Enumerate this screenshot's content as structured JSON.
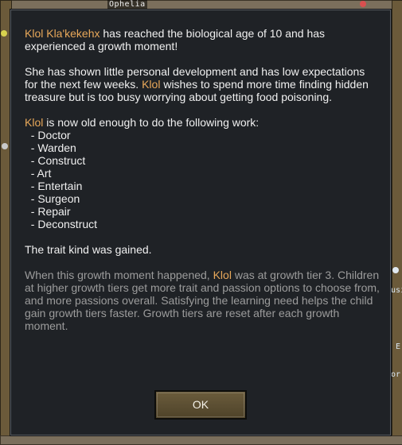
{
  "game": {
    "pawn_label": "Ophelia",
    "side_fragments": [
      "usi",
      "E",
      "or"
    ]
  },
  "dialog": {
    "para1": {
      "name": "Klol Kla'kekehx",
      "text": " has reached the biological age of 10 and has experienced a growth moment!"
    },
    "para2": {
      "text_a": "She has shown little personal development and has low expectations for the next few weeks. ",
      "name": "Klol",
      "text_b": " wishes to spend more time finding hidden treasure but is too busy worrying about getting food poisoning."
    },
    "para3": {
      "name": "Klol",
      "text": " is now old enough to do the following work:",
      "work_items": [
        "  - Doctor",
        "  - Warden",
        "  - Construct",
        "  - Art",
        "  - Entertain",
        "  - Surgeon",
        "  - Repair",
        "  - Deconstruct"
      ]
    },
    "trait_text": "The trait kind was gained.",
    "info": {
      "text_a": "When this growth moment happened, ",
      "name": "Klol",
      "text_b": " was at growth tier 3. Children at higher growth tiers get more trait and passion options to choose from, and more passions overall. Satisfying the learning need helps the child gain growth tiers faster. Growth tiers are reset after each growth moment."
    },
    "ok_label": "OK"
  },
  "colors": {
    "name_highlight": "#e8a85a",
    "dialog_bg": "#1f2226",
    "button_bg": "#5b4e32"
  }
}
